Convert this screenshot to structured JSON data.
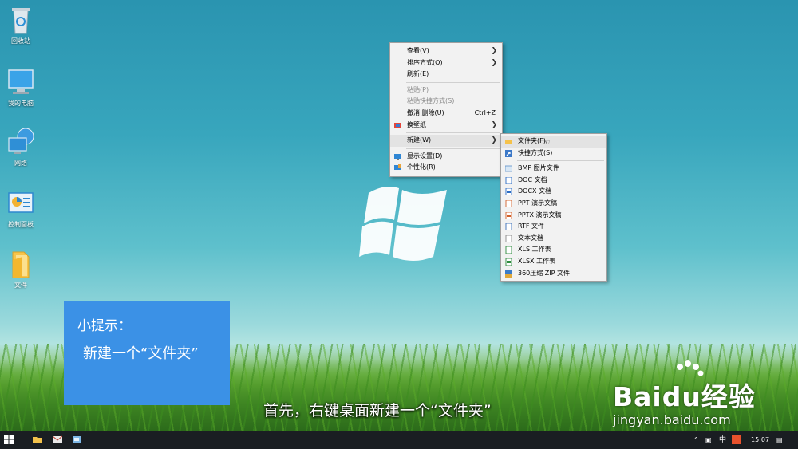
{
  "desktop": {
    "icons": [
      {
        "label": "回收站",
        "icon": "recycle-bin-icon"
      },
      {
        "label": "我的电脑",
        "icon": "computer-icon"
      },
      {
        "label": "网络",
        "icon": "network-icon"
      },
      {
        "label": "控制面板",
        "icon": "control-panel-icon"
      },
      {
        "label": "文件",
        "icon": "folder-icon"
      }
    ]
  },
  "context_menu": {
    "items": [
      {
        "label": "查看(V)",
        "submenu": true
      },
      {
        "label": "排序方式(O)",
        "submenu": true
      },
      {
        "label": "刷新(E)"
      },
      {
        "label": "粘贴(P)",
        "disabled": true
      },
      {
        "label": "粘贴快捷方式(S)",
        "disabled": true
      },
      {
        "label": "撤消 删除(U)",
        "shortcut": "Ctrl+Z"
      },
      {
        "label": "换壁纸",
        "submenu": true,
        "icon": "wallpaper-icon"
      },
      {
        "label": "新建(W)",
        "submenu": true,
        "highlighted": true
      },
      {
        "label": "显示设置(D)",
        "icon": "display-settings-icon"
      },
      {
        "label": "个性化(R)",
        "icon": "personalize-icon"
      }
    ]
  },
  "new_submenu": {
    "items": [
      {
        "label": "文件夹(F)",
        "icon": "folder-icon"
      },
      {
        "label": "快捷方式(S)",
        "icon": "shortcut-icon"
      },
      {
        "label": "BMP 图片文件",
        "icon": "bmp-file-icon"
      },
      {
        "label": "DOC 文档",
        "icon": "doc-file-icon"
      },
      {
        "label": "DOCX 文档",
        "icon": "docx-file-icon"
      },
      {
        "label": "PPT 演示文稿",
        "icon": "ppt-file-icon"
      },
      {
        "label": "PPTX 演示文稿",
        "icon": "pptx-file-icon"
      },
      {
        "label": "RTF 文件",
        "icon": "rtf-file-icon"
      },
      {
        "label": "文本文档",
        "icon": "txt-file-icon"
      },
      {
        "label": "XLS 工作表",
        "icon": "xls-file-icon"
      },
      {
        "label": "XLSX 工作表",
        "icon": "xlsx-file-icon"
      },
      {
        "label": "360压缩 ZIP 文件",
        "icon": "zip-file-icon"
      }
    ]
  },
  "tip": {
    "title": "小提示：",
    "body": "新建一个“文件夹”"
  },
  "subtitle": "首先，右键桌面新建一个“文件夹”",
  "watermark": {
    "brand": "Baidu经验",
    "url": "jingyan.baidu.com"
  },
  "taskbar": {
    "ime": "中",
    "clock": "15:07"
  },
  "colors": {
    "tip_background": "#3b91e6",
    "taskbar": "#1a1e22",
    "menu_background": "#f2f2f2"
  }
}
